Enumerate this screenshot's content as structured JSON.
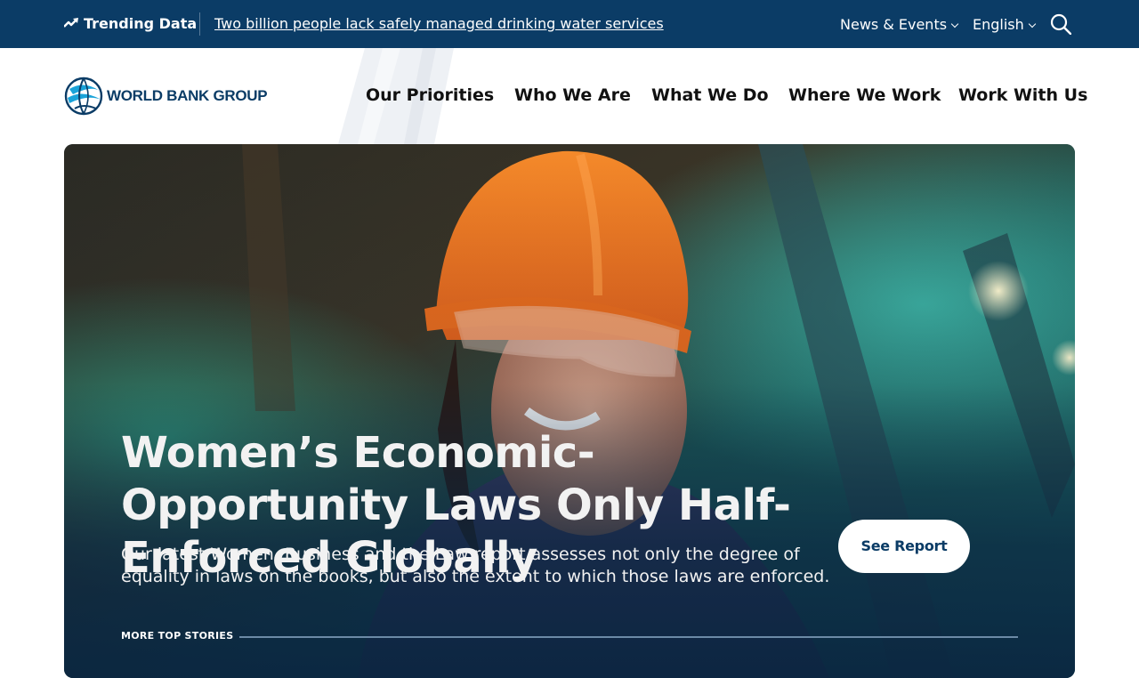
{
  "topbar": {
    "trending_label": "Trending Data",
    "trending_link": "Two billion people lack safely managed drinking water services",
    "news_events": "News & Events",
    "language": "English",
    "trend_icon": "trending-up-icon",
    "search_icon": "search-icon"
  },
  "header": {
    "logo_text": "WORLD BANK GROUP",
    "nav": [
      "Our Priorities",
      "Who We Are",
      "What We Do",
      "Where We Work",
      "Work With Us"
    ]
  },
  "hero": {
    "title": "Women’s Economic-Opportunity Laws Only Half-Enforced Globally",
    "description": "Our latest Women, Business and the Law report assesses not only the degree of equality in laws on the books, but also the extent to which those laws are enforced.",
    "cta": "See Report",
    "more_label": "MORE TOP STORIES"
  },
  "colors": {
    "topbar_bg": "#0b3c66",
    "brand_blue": "#0b3c66",
    "logo_accent": "#1aa3d9",
    "hardhat_orange": "#f07a1a"
  }
}
